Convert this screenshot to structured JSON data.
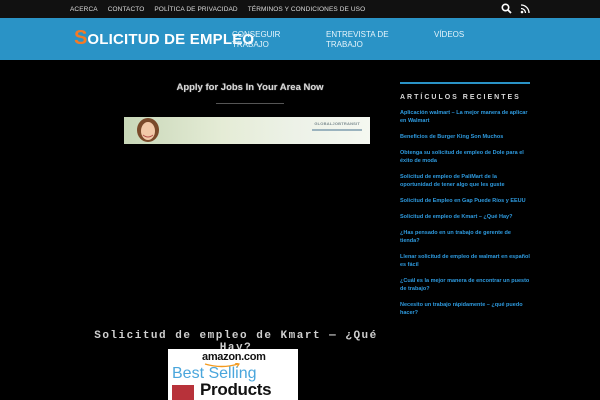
{
  "topbar": {
    "links": [
      "ACERCA",
      "CONTACTO",
      "POLÍTICA DE PRIVACIDAD",
      "TÉRMINOS Y CONDICIONES DE USO"
    ],
    "icons": [
      "search-icon",
      "rss-icon"
    ]
  },
  "header": {
    "logo_first": "S",
    "logo_rest": "OLICITUD DE EMPLEO",
    "nav": [
      {
        "line1": "CONSEGUIR",
        "line2": "TRABAJO"
      },
      {
        "line1": "ENTREVISTA DE",
        "line2": "TRABAJO"
      },
      {
        "line1": "VÍDEOS",
        "line2": ""
      }
    ]
  },
  "main": {
    "apply_title": "Apply for Jobs In Your Area Now",
    "banner_brand": "GLOBALJOBTRANSIT",
    "bottom_title": "Solicitud de empleo de Kmart — ¿Qué Hay?"
  },
  "sidebar": {
    "heading": "ARTÍCULOS RECIENTES",
    "items": [
      "Aplicación walmart – La mejor manera de aplicar en Walmart",
      "Beneficios de Burger King Son Muchos",
      "Obtenga su solicitud de empleo de Dole para el éxito de moda",
      "Solicitud de empleo de PaliMart de la oportunidad de tener algo que les guste",
      "Solicitud de Empleo en Gap Puede Ríos y EEUU",
      "Solicitud de empleo de Kmart – ¿Qué Hay?",
      "¿Has pensado en un trabajo de gerente de tienda?",
      "Llenar solicitud de empleo de walmart en español es fácil",
      "¿Cuál es la mejor manera de encontrar un puesto de trabajo?",
      "Necesito un trabajo rápidamente – ¿qué puedo hacer?"
    ]
  },
  "amazon": {
    "logo": "amazon.com",
    "line1": "Best Selling",
    "line2": "Products"
  },
  "colors": {
    "header_bg": "#2a93c6",
    "logo_accent": "#f47a26",
    "link": "#2e9be0",
    "page_bg": "#000000"
  }
}
